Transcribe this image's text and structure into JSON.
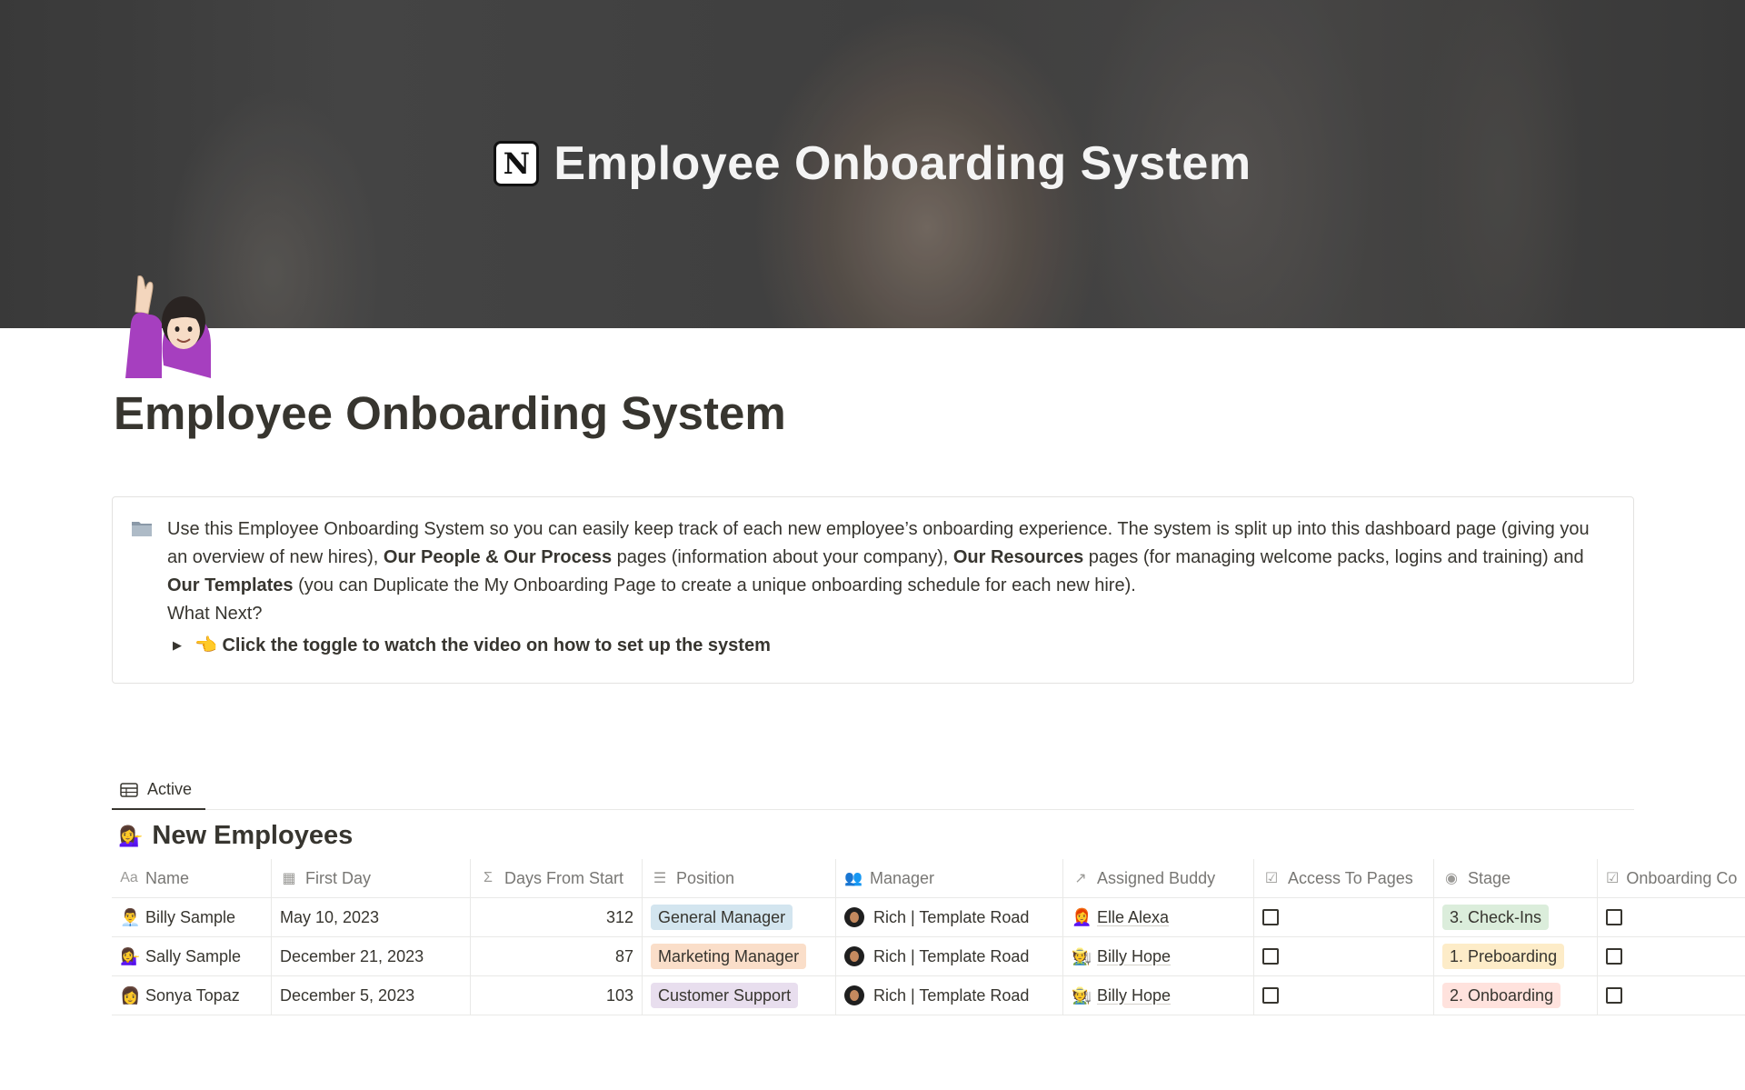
{
  "cover": {
    "title": "Employee Onboarding System",
    "logo_letter": "N"
  },
  "page": {
    "icon": "raising-hand-woman-icon",
    "title": "Employee Onboarding System"
  },
  "callout": {
    "icon": "folder-icon",
    "text_1": "Use this Employee Onboarding System so you can easily keep track of each new employee’s onboarding experience. The system is split up into this dashboard page (giving you an overview of new hires), ",
    "bold_1": "Our People & Our Process",
    "text_2": " pages (information about your company), ",
    "bold_2": "Our Resources",
    "text_3": " pages (for managing welcome packs, logins and training) and ",
    "bold_3": "Our Templates",
    "text_4": " (you can Duplicate the My Onboarding Page to create a unique onboarding schedule for each new hire).",
    "what_next": "What Next?",
    "toggle_label": "👈 Click the toggle to watch the video on how to set up the system"
  },
  "tabs": [
    {
      "label": "Active"
    }
  ],
  "database": {
    "title": "New Employees",
    "columns": [
      {
        "label": "Name",
        "icon": "Aa"
      },
      {
        "label": "First Day",
        "icon": "calendar"
      },
      {
        "label": "Days From Start",
        "icon": "Σ"
      },
      {
        "label": "Position",
        "icon": "list"
      },
      {
        "label": "Manager",
        "icon": "people"
      },
      {
        "label": "Assigned Buddy",
        "icon": "relation"
      },
      {
        "label": "Access To Pages",
        "icon": "checkbox"
      },
      {
        "label": "Stage",
        "icon": "status"
      },
      {
        "label": "Onboarding Co",
        "icon": "checkbox"
      }
    ],
    "rows": [
      {
        "name": "Billy Sample",
        "name_icon": "👨‍💼",
        "first_day": "May 10, 2023",
        "days": "312",
        "position": "General Manager",
        "position_color": "#d3e5ef",
        "manager": "Rich | Template Road",
        "buddy": "Elle Alexa",
        "buddy_icon": "👩‍🦰",
        "access": false,
        "stage": "3. Check-Ins",
        "stage_color": "#dbeddb",
        "complete": false
      },
      {
        "name": "Sally Sample",
        "name_icon": "💁‍♀️",
        "first_day": "December 21, 2023",
        "days": "87",
        "position": "Marketing Manager",
        "position_color": "#fadec9",
        "manager": "Rich | Template Road",
        "buddy": "Billy Hope",
        "buddy_icon": "🧑‍🌾",
        "access": false,
        "stage": "1. Preboarding",
        "stage_color": "#fdecc8",
        "complete": false
      },
      {
        "name": "Sonya Topaz",
        "name_icon": "👩",
        "first_day": "December 5, 2023",
        "days": "103",
        "position": "Customer Support",
        "position_color": "#e8deee",
        "manager": "Rich | Template Road",
        "buddy": "Billy Hope",
        "buddy_icon": "🧑‍🌾",
        "access": false,
        "stage": "2. Onboarding",
        "stage_color": "#ffe2dd",
        "complete": false
      }
    ]
  }
}
